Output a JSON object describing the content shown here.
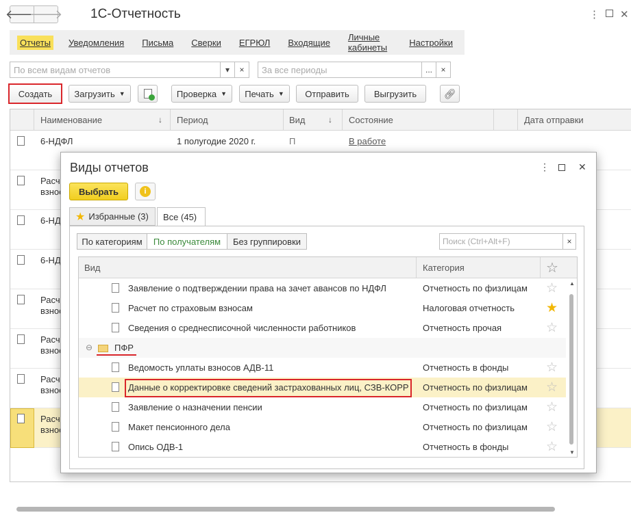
{
  "app": {
    "title": "1С-Отчетность"
  },
  "window_controls": {
    "more": "⋮",
    "minimize": "▫",
    "close": "✕"
  },
  "menu": [
    "Отчеты",
    "Уведомления",
    "Письма",
    "Сверки",
    "ЕГРЮЛ",
    "Входящие",
    "Личные кабинеты",
    "Настройки"
  ],
  "filters": {
    "kind_placeholder": "По всем видам отчетов",
    "period_placeholder": "За все периоды",
    "dropdown": "▾",
    "clear": "×",
    "ellipsis": "..."
  },
  "toolbar": {
    "create": "Создать",
    "load": "Загрузить",
    "check": "Проверка",
    "print": "Печать",
    "send": "Отправить",
    "export": "Выгрузить"
  },
  "main_table": {
    "columns": [
      "Наименование",
      "Период",
      "Вид",
      "Состояние",
      "Дата отправки"
    ],
    "rows": [
      {
        "name": "6-НДФЛ",
        "name2": "",
        "period": "1 полугодие 2020 г.",
        "kind": "П",
        "state": "В работе"
      },
      {
        "name": "Расч",
        "name2": "взнос"
      },
      {
        "name": "6-НД",
        "name2": ""
      },
      {
        "name": "6-НД",
        "name2": ""
      },
      {
        "name": "Расч",
        "name2": "взнос"
      },
      {
        "name": "Расч",
        "name2": "взнос"
      },
      {
        "name": "Расч",
        "name2": "взнос"
      },
      {
        "name": "Расч",
        "name2": "взнос"
      }
    ]
  },
  "dialog": {
    "title": "Виды отчетов",
    "select": "Выбрать",
    "info": "i",
    "tabs": [
      "Избранные (3)",
      "Все (45)"
    ],
    "grouping": [
      "По категориям",
      "По получателям",
      "Без группировки"
    ],
    "search_placeholder": "Поиск (Ctrl+Alt+F)",
    "columns": {
      "kind": "Вид",
      "category": "Категория"
    },
    "rows": [
      {
        "name": "Заявление о подтверждении права на зачет авансов по НДФЛ",
        "category": "Отчетность по физлицам",
        "fav": false
      },
      {
        "name": "Расчет по страховым взносам",
        "category": "Налоговая отчетность",
        "fav": true
      },
      {
        "name": "Сведения о среднесписочной численности работников",
        "category": "Отчетность прочая",
        "fav": false
      }
    ],
    "group": {
      "toggle": "⊖",
      "name": "ПФР"
    },
    "group_rows": [
      {
        "name": "Ведомость уплаты взносов АДВ-11",
        "category": "Отчетность в фонды",
        "fav": false
      },
      {
        "name": "Данные о корректировке сведений застрахованных лиц, СЗВ-КОРР",
        "category": "Отчетность по физлицам",
        "fav": false
      },
      {
        "name": "Заявление о назначении пенсии",
        "category": "Отчетность по физлицам",
        "fav": false
      },
      {
        "name": "Макет пенсионного дела",
        "category": "Отчетность по физлицам",
        "fav": false
      },
      {
        "name": "Опись ОДВ-1",
        "category": "Отчетность в фонды",
        "fav": false
      }
    ]
  },
  "colors": {
    "accent": "#f2cc2a",
    "highlight_border": "#d9252a",
    "selected_row": "#fbf1c7"
  }
}
